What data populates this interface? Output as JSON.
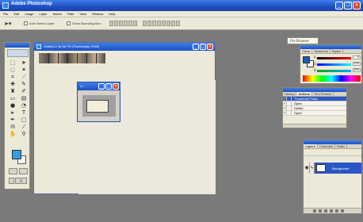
{
  "app": {
    "title": "Adobe Photoshop"
  },
  "menu": [
    "File",
    "Edit",
    "Image",
    "Layer",
    "Select",
    "Filter",
    "View",
    "Window",
    "Help"
  ],
  "options": {
    "auto_select": "Auto Select Layer",
    "bounding_box": "Show Bounding Box",
    "file_browser": "File Browser"
  },
  "document": {
    "title": "Untitled-1 @ 66.7% (Thumbnails, RGB)"
  },
  "mini_window": {
    "title": "U..."
  },
  "color_panel": {
    "tabs": [
      "Color",
      "Swatches",
      "Styles"
    ],
    "channels": [
      {
        "label": "R",
        "value": "0"
      },
      {
        "label": "G",
        "value": "102"
      },
      {
        "label": "B",
        "value": "204"
      }
    ]
  },
  "actions_panel": {
    "tabs": [
      "History",
      "Actions",
      "Tool Presets"
    ],
    "rows": [
      {
        "label": "Thumbnail Paths",
        "selected": true
      },
      {
        "label": "Open",
        "selected": false
      },
      {
        "label": "Delete",
        "selected": false
      },
      {
        "label": "Open",
        "selected": false
      }
    ]
  },
  "layers_panel": {
    "tabs": [
      "Layers",
      "Channels",
      "Paths"
    ],
    "layer_name": "Background"
  },
  "colors": {
    "title_blue": "#1e4fc2",
    "foreground": "#2f9ee8",
    "selection": "#2b57c6"
  }
}
